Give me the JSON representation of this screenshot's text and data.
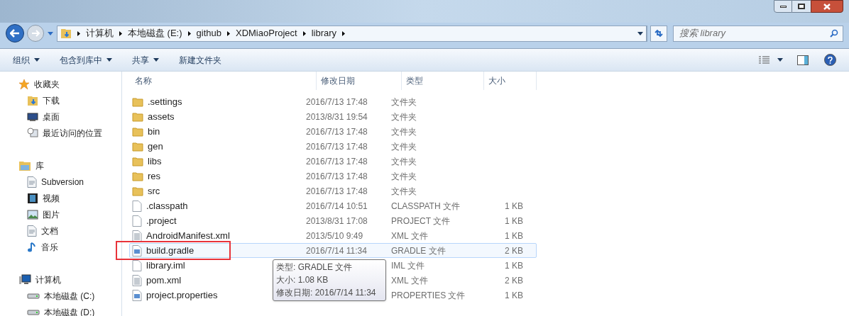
{
  "address_bar": {
    "crumbs": [
      "计算机",
      "本地磁盘 (E:)",
      "github",
      "XDMiaoProject",
      "library"
    ]
  },
  "search": {
    "placeholder": "搜索 library"
  },
  "toolbar": {
    "buttons": [
      {
        "label": "组织",
        "dropdown": true
      },
      {
        "label": "包含到库中",
        "dropdown": true
      },
      {
        "label": "共享",
        "dropdown": true
      },
      {
        "label": "新建文件夹",
        "dropdown": false
      }
    ]
  },
  "sidebar": {
    "groups": [
      {
        "label": "收藏夹",
        "children": [
          {
            "label": "下载"
          },
          {
            "label": "桌面"
          },
          {
            "label": "最近访问的位置"
          }
        ]
      },
      {
        "label": "库",
        "children": [
          {
            "label": "Subversion"
          },
          {
            "label": "视频"
          },
          {
            "label": "图片"
          },
          {
            "label": "文档"
          },
          {
            "label": "音乐"
          }
        ]
      },
      {
        "label": "计算机",
        "children": [
          {
            "label": "本地磁盘 (C:)"
          },
          {
            "label": "本地磁盘 (D:)"
          }
        ]
      }
    ]
  },
  "table": {
    "columns": [
      "名称",
      "修改日期",
      "类型",
      "大小"
    ],
    "rows": [
      {
        "kind": "folder",
        "name": ".settings",
        "date": "2016/7/13 17:48",
        "type": "文件夹",
        "hovered": false,
        "annotated": false
      },
      {
        "kind": "folder",
        "name": "assets",
        "date": "2013/8/31 19:54",
        "type": "文件夹",
        "hovered": false,
        "annotated": false
      },
      {
        "kind": "folder",
        "name": "bin",
        "date": "2016/7/13 17:48",
        "type": "文件夹",
        "hovered": false,
        "annotated": false
      },
      {
        "kind": "folder",
        "name": "gen",
        "date": "2016/7/13 17:48",
        "type": "文件夹",
        "hovered": false,
        "annotated": false
      },
      {
        "kind": "folder",
        "name": "libs",
        "date": "2016/7/13 17:48",
        "type": "文件夹",
        "hovered": false,
        "annotated": false
      },
      {
        "kind": "folder",
        "name": "res",
        "date": "2016/7/13 17:48",
        "type": "文件夹",
        "hovered": false,
        "annotated": false
      },
      {
        "kind": "folder",
        "name": "src",
        "date": "2016/7/13 17:48",
        "type": "文件夹",
        "hovered": false,
        "annotated": false
      },
      {
        "kind": "file",
        "name": ".classpath",
        "date": "2016/7/14 10:51",
        "type": "CLASSPATH 文件",
        "size": "1 KB",
        "hovered": false,
        "annotated": false
      },
      {
        "kind": "file",
        "name": ".project",
        "date": "2013/8/31 17:08",
        "type": "PROJECT 文件",
        "size": "1 KB",
        "hovered": false,
        "annotated": false
      },
      {
        "kind": "text",
        "name": "AndroidManifest.xml",
        "date": "2013/5/10 9:49",
        "type": "XML 文件",
        "size": "1 KB",
        "hovered": false,
        "annotated": false
      },
      {
        "kind": "config",
        "name": "build.gradle",
        "date": "2016/7/14 11:34",
        "type": "GRADLE 文件",
        "size": "2 KB",
        "hovered": true,
        "annotated": true
      },
      {
        "kind": "file",
        "name": "library.iml",
        "type": "IML 文件",
        "size": "1 KB",
        "hovered": false,
        "annotated": false
      },
      {
        "kind": "text",
        "name": "pom.xml",
        "type": "XML 文件",
        "size": "2 KB",
        "hovered": false,
        "annotated": false
      },
      {
        "kind": "config",
        "name": "project.properties",
        "type": "PROPERTIES 文件",
        "size": "1 KB",
        "hovered": false,
        "annotated": false
      }
    ]
  },
  "tooltip": {
    "lines": [
      "类型: GRADLE 文件",
      "大小: 1.08 KB",
      "修改日期: 2016/7/14 11:34"
    ]
  }
}
